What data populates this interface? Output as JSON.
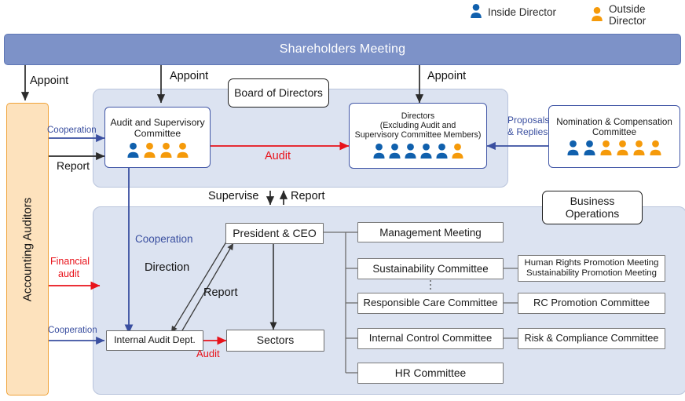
{
  "legend": {
    "inside": {
      "label": "Inside Director",
      "color": "#1060ad",
      "icon": "person-icon"
    },
    "outside": {
      "label": "Outside Director",
      "color": "#f59a0a",
      "icon": "person-icon"
    }
  },
  "colors": {
    "shareholders_bar": "#7d92c8",
    "panel": "#dce3f1",
    "auditor_box": "#fde2bd",
    "auditor_border": "#f0a33a",
    "blue_arrow": "#3a4fa0",
    "red_arrow": "#e8121a",
    "black_arrow": "#2b2b2b"
  },
  "shareholders": {
    "title": "Shareholders Meeting"
  },
  "accounting_auditors": {
    "title": "Accounting Auditors"
  },
  "board_panel": {
    "title": "Board of Directors"
  },
  "business_panel": {
    "title": "Business Operations"
  },
  "audit_committee": {
    "title_line1": "Audit and Supervisory",
    "title_line2": "Committee",
    "members": [
      "inside",
      "outside",
      "outside",
      "outside"
    ]
  },
  "directors": {
    "title_line1": "Directors",
    "title_line2": "(Excluding Audit and",
    "title_line3": "Supervisory Committee Members)",
    "members": [
      "inside",
      "inside",
      "inside",
      "inside",
      "inside",
      "outside"
    ]
  },
  "nomination_committee": {
    "title_line1": "Nomination & Compensation",
    "title_line2": "Committee",
    "members": [
      "inside",
      "inside",
      "outside",
      "outside",
      "outside",
      "outside"
    ]
  },
  "operations": {
    "president": "President & CEO",
    "internal_audit": "Internal Audit Dept.",
    "sectors": "Sectors"
  },
  "committees": [
    {
      "name": "Management Meeting",
      "sub": null
    },
    {
      "name": "Sustainability Committee",
      "sub": "Human Rights Promotion Meeting\nSustainability Promotion Meeting"
    },
    {
      "name": "Responsible Care Committee",
      "sub": "RC Promotion Committee"
    },
    {
      "name": "Internal Control Committee",
      "sub": "Risk & Compliance Committee"
    },
    {
      "name": "HR Committee",
      "sub": null
    }
  ],
  "committee_labels": {
    "c0": "Management Meeting",
    "c1": "Sustainability Committee",
    "c2": "Responsible Care Committee",
    "c3": "Internal Control Committee",
    "c4": "HR Committee",
    "s1a": "Human Rights Promotion Meeting",
    "s1b": "Sustainability Promotion Meeting",
    "s2": "RC Promotion Committee",
    "s3": "Risk & Compliance Committee"
  },
  "edge_labels": {
    "appoint_auditor": "Appoint",
    "appoint_audit_committee": "Appoint",
    "appoint_directors": "Appoint",
    "cooperation_top": "Cooperation",
    "report_top": "Report",
    "audit_board": "Audit",
    "proposals_line1": "Proposals",
    "proposals_line2": "& Replies",
    "supervise": "Supervise",
    "report_board": "Report",
    "cooperation_mid": "Cooperation",
    "direction": "Direction",
    "report_ceo": "Report",
    "financial_audit_line1": "Financial",
    "financial_audit_line2": "audit",
    "cooperation_bottom": "Cooperation",
    "audit_internal": "Audit"
  }
}
